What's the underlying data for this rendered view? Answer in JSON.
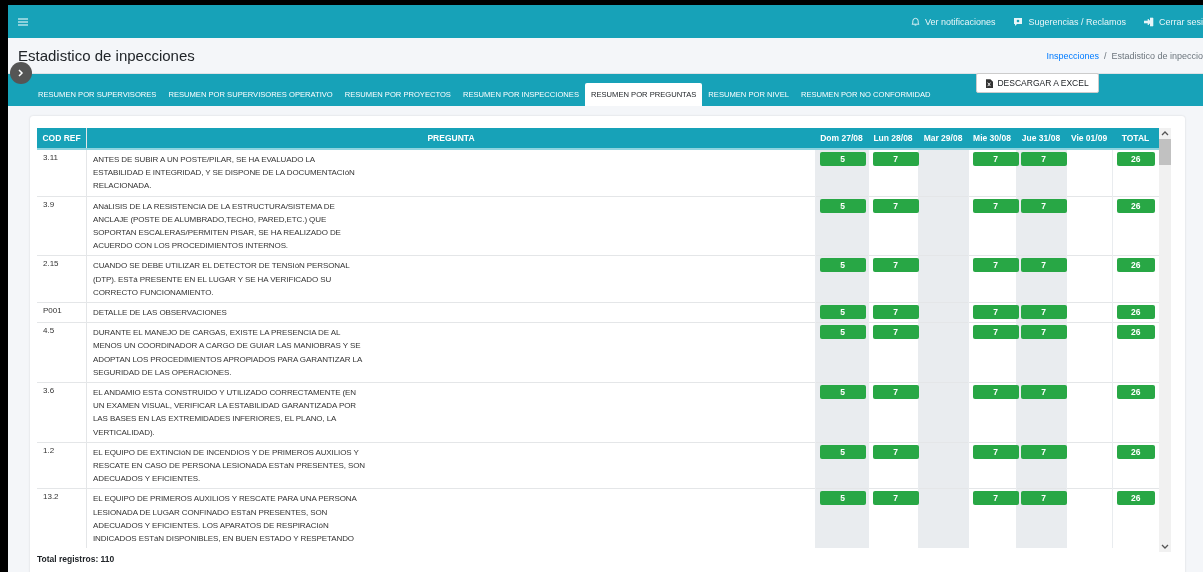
{
  "topbar": {
    "actions": [
      {
        "kind": "bell",
        "label": "Ver notificaciones"
      },
      {
        "kind": "chat",
        "label": "Sugerencias / Reclamos"
      },
      {
        "kind": "logout",
        "label": "Cerrar sesi"
      }
    ]
  },
  "page": {
    "title": "Estadistico de inpecciones",
    "breadcrumb": {
      "items": [
        "Inspecciones",
        "Estadistico de inpeccio"
      ],
      "separator": "/"
    }
  },
  "tabs": [
    {
      "label": "RESUMEN POR SUPERVISORES",
      "selected": false
    },
    {
      "label": "RESUMEN POR SUPERVISORES OPERATIVO",
      "selected": false
    },
    {
      "label": "RESUMEN POR PROYECTOS",
      "selected": false
    },
    {
      "label": "RESUMEN POR INSPECCIONES",
      "selected": false
    },
    {
      "label": "RESUMEN POR PREGUNTAS",
      "selected": true
    },
    {
      "label": "RESUMEN POR NIVEL",
      "selected": false
    },
    {
      "label": "RESUMEN POR NO CONFORMIDAD",
      "selected": false
    }
  ],
  "export_button": "DESCARGAR A EXCEL",
  "table": {
    "columns": [
      "COD REF",
      "PREGUNTA",
      "Dom 27/08",
      "Lun 28/08",
      "Mar 29/08",
      "Mie 30/08",
      "Jue 31/08",
      "Vie 01/09",
      "TOTAL"
    ],
    "rows": [
      {
        "code": "3.11",
        "question": "ANTES DE SUBIR A UN POSTE/PILAR, SE HA EVALUADO LA ESTABILIDAD E INTEGRIDAD, Y SE DISPONE DE LA DOCUMENTACIóN RELACIONADA.",
        "counts": [
          {
            "filled": true,
            "value": "5"
          },
          {
            "filled": true,
            "value": "7"
          },
          {
            "filled": false
          },
          {
            "filled": true,
            "value": "7"
          },
          {
            "filled": true,
            "value": "7"
          },
          {
            "filled": false
          }
        ],
        "total": "26"
      },
      {
        "code": "3.9",
        "question": "ANáLISIS DE LA RESISTENCIA DE LA ESTRUCTURA/SISTEMA DE ANCLAJE (POSTE DE ALUMBRADO,TECHO, PARED,ETC.) QUE SOPORTAN ESCALERAS/PERMITEN PISAR, SE HA REALIZADO DE ACUERDO CON LOS PROCEDIMIENTOS INTERNOS.",
        "counts": [
          {
            "filled": true,
            "value": "5"
          },
          {
            "filled": true,
            "value": "7"
          },
          {
            "filled": false
          },
          {
            "filled": true,
            "value": "7"
          },
          {
            "filled": true,
            "value": "7"
          },
          {
            "filled": false
          }
        ],
        "total": "26"
      },
      {
        "code": "2.15",
        "question": "CUANDO SE DEBE UTILIZAR EL DETECTOR DE TENSIóN PERSONAL (DTP). ESTá PRESENTE EN EL LUGAR Y SE HA VERIFICADO SU CORRECTO FUNCIONAMIENTO.",
        "counts": [
          {
            "filled": true,
            "value": "5"
          },
          {
            "filled": true,
            "value": "7"
          },
          {
            "filled": false
          },
          {
            "filled": true,
            "value": "7"
          },
          {
            "filled": true,
            "value": "7"
          },
          {
            "filled": false
          }
        ],
        "total": "26"
      },
      {
        "code": "P001",
        "question": "DETALLE DE LAS OBSERVACIONES",
        "counts": [
          {
            "filled": true,
            "value": "5"
          },
          {
            "filled": true,
            "value": "7"
          },
          {
            "filled": false
          },
          {
            "filled": true,
            "value": "7"
          },
          {
            "filled": true,
            "value": "7"
          },
          {
            "filled": false
          }
        ],
        "total": "26"
      },
      {
        "code": "4.5",
        "question": "DURANTE EL MANEJO DE CARGAS, EXISTE LA PRESENCIA DE AL MENOS UN COORDINADOR A CARGO DE GUIAR LAS MANIOBRAS Y SE ADOPTAN LOS PROCEDIMIENTOS APROPIADOS PARA GARANTIZAR LA SEGURIDAD DE LAS OPERACIONES.",
        "counts": [
          {
            "filled": true,
            "value": "5"
          },
          {
            "filled": true,
            "value": "7"
          },
          {
            "filled": false
          },
          {
            "filled": true,
            "value": "7"
          },
          {
            "filled": true,
            "value": "7"
          },
          {
            "filled": false
          }
        ],
        "total": "26"
      },
      {
        "code": "3.6",
        "question": "EL ANDAMIO ESTá CONSTRUIDO Y UTILIZADO CORRECTAMENTE (EN UN EXAMEN VISUAL, VERIFICAR LA ESTABILIDAD GARANTIZADA POR LAS BASES EN LAS EXTREMIDADES INFERIORES, EL PLANO, LA VERTICALIDAD).",
        "counts": [
          {
            "filled": true,
            "value": "5"
          },
          {
            "filled": true,
            "value": "7"
          },
          {
            "filled": false
          },
          {
            "filled": true,
            "value": "7"
          },
          {
            "filled": true,
            "value": "7"
          },
          {
            "filled": false
          }
        ],
        "total": "26"
      },
      {
        "code": "1.2",
        "question": "EL EQUIPO DE EXTINCIóN DE INCENDIOS Y DE PRIMEROS AUXILIOS Y RESCATE EN CASO DE PERSONA LESIONADA ESTáN PRESENTES, SON ADECUADOS Y EFICIENTES.",
        "counts": [
          {
            "filled": true,
            "value": "5"
          },
          {
            "filled": true,
            "value": "7"
          },
          {
            "filled": false
          },
          {
            "filled": true,
            "value": "7"
          },
          {
            "filled": true,
            "value": "7"
          },
          {
            "filled": false
          }
        ],
        "total": "26"
      },
      {
        "code": "13.2",
        "question": "EL EQUIPO DE PRIMEROS AUXILIOS Y RESCATE PARA UNA PERSONA LESIONADA DE LUGAR CONFINADO ESTáN PRESENTES, SON ADECUADOS Y EFICIENTES. LOS APARATOS DE RESPIRACIóN INDICADOS ESTáN DISPONIBLES, EN BUEN ESTADO Y RESPETANDO",
        "counts": [
          {
            "filled": true,
            "value": "5"
          },
          {
            "filled": true,
            "value": "7"
          },
          {
            "filled": false
          },
          {
            "filled": true,
            "value": "7"
          },
          {
            "filled": true,
            "value": "7"
          },
          {
            "filled": false
          }
        ],
        "total": "26"
      }
    ]
  },
  "footer": "Total registros: 110"
}
